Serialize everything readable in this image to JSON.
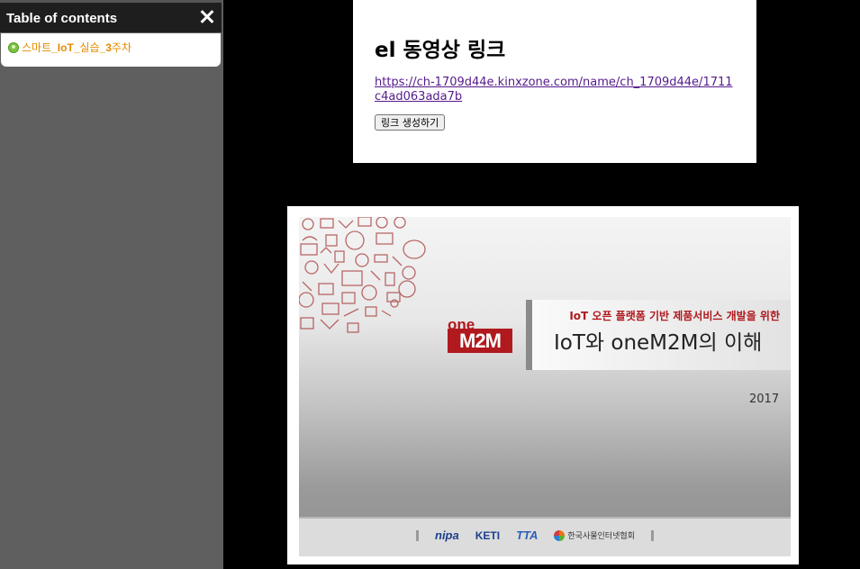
{
  "toc": {
    "title": "Table of contents",
    "items": [
      {
        "label_parts": [
          "스마트",
          "_IoT_",
          "실습",
          "_3",
          "주차"
        ]
      }
    ]
  },
  "card": {
    "title": "el 동영상 링크",
    "link": "https://ch-1709d44e.kinxzone.com/name/ch_1709d44e/1711c4ad063ada7b",
    "button": "링크 생성하기"
  },
  "slide": {
    "subtitle": "IoT 오픈 플랫폼 기반 제품서비스 개발을 위한",
    "title": "IoT와 oneM2M의 이해",
    "year": "2017",
    "logo_top": "one",
    "logo_bottom": "M2M",
    "partners": [
      "nipa",
      "KETI",
      "TTA",
      "한국사물인터넷협회"
    ]
  },
  "colors": {
    "accent": "#b0191e",
    "toc_item": "#e38c00",
    "sidebar": "#5f5f5f"
  }
}
